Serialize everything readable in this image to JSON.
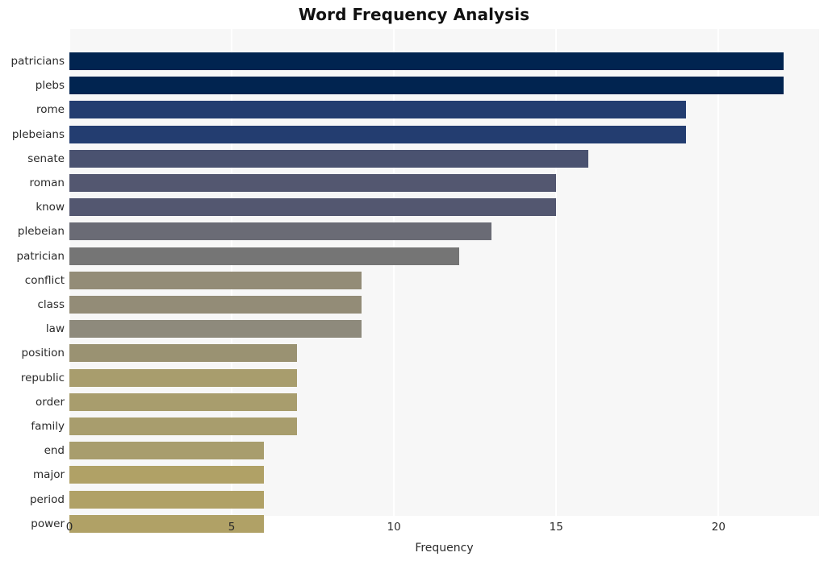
{
  "chart_data": {
    "type": "bar",
    "orientation": "horizontal",
    "title": "Word Frequency Analysis",
    "xlabel": "Frequency",
    "ylabel": "",
    "xlim": [
      0,
      23.1
    ],
    "xticks": [
      0,
      5,
      10,
      15,
      20
    ],
    "xtick_labels": [
      "0",
      "5",
      "10",
      "15",
      "20"
    ],
    "grid": "vertical-white-on-gray",
    "legend": "none",
    "categories": [
      "patricians",
      "plebs",
      "rome",
      "plebeians",
      "senate",
      "roman",
      "know",
      "plebeian",
      "patrician",
      "conflict",
      "class",
      "law",
      "position",
      "republic",
      "order",
      "family",
      "end",
      "major",
      "period",
      "power"
    ],
    "values": [
      22,
      22,
      19,
      19,
      16,
      15,
      15,
      13,
      12,
      9,
      9,
      9,
      7,
      7,
      7,
      7,
      6,
      6,
      6,
      6
    ],
    "bar_colors": [
      "#012450",
      "#012450",
      "#233d70",
      "#233d70",
      "#4a5270",
      "#535770",
      "#535770",
      "#6a6b75",
      "#757575",
      "#938c77",
      "#938c77",
      "#8e8a7c",
      "#9a9272",
      "#a89d6d",
      "#a89d6d",
      "#a89d6d",
      "#a89d6d",
      "#b0a166",
      "#b0a166",
      "#b0a166"
    ],
    "plot_background": "#f7f7f7",
    "figure_background": "#ffffff",
    "gridline_color": "#ffffff"
  }
}
